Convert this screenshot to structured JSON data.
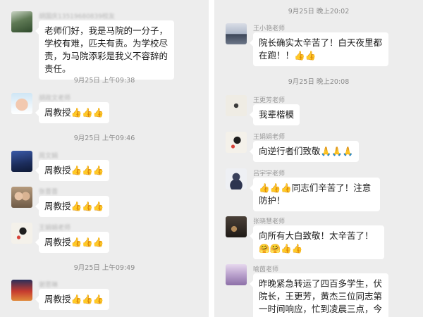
{
  "left": {
    "timestamps": [
      "9月25日 上午09:38",
      "9月25日 上午09:46",
      "9月25日 上午09:49"
    ],
    "messages": [
      {
        "sender": "胡国庆13519680839校友",
        "text": "老师们好，我是马院的一分子，学校有难，匹夫有责。为学校尽责，为马院添彩是我义不容辞的责任。",
        "avatar": "tree-photo-avatar"
      },
      {
        "sender": "胡政文老师",
        "text": "周教授👍👍👍",
        "avatar": "baby-photo-avatar"
      },
      {
        "sender": "周文娟",
        "text": "周教授👍👍👍",
        "avatar": "night-scene-avatar"
      },
      {
        "sender": "张晋晋",
        "text": "周教授👍👍👍",
        "avatar": "couple-photo-avatar"
      },
      {
        "sender": "王娟娟老师",
        "text": "周教授👍👍👍",
        "avatar": "ink-painting-avatar"
      },
      {
        "sender": "谢思琳",
        "text": "周教授👍👍👍",
        "avatar": "red-room-avatar"
      }
    ]
  },
  "right": {
    "timestamps": [
      "9月25日 晚上20:02",
      "9月25日 晚上20:08"
    ],
    "messages": [
      {
        "sender": "王小艳老师",
        "text": "院长确实太辛苦了！白天夜里都在跑！！👍👍",
        "avatar": "lake-photo-avatar"
      },
      {
        "sender": "王更芳老师",
        "text": "我辈楷模",
        "avatar": "calligraphy-avatar"
      },
      {
        "sender": "王娟娟老师",
        "text": "向逆行者们致敬🙏🙏🙏",
        "avatar": "ink-painting-avatar"
      },
      {
        "sender": "吕宇宇老师",
        "text": "👍👍👍同志们辛苦了！注意防护！",
        "avatar": "cartoon-character-avatar"
      },
      {
        "sender": "张晓慧老师",
        "text": "向所有大白致敬！太辛苦了！🤗🤗👍👍",
        "avatar": "dark-photo-avatar"
      },
      {
        "sender": "喻茵老师",
        "text": "昨晚紧急转运了四百多学生，伏院长，王更芳，黄杰三位同志第一时间响应，忙到凌晨三点，今天又是",
        "avatar": "purple-sky-avatar"
      }
    ]
  }
}
